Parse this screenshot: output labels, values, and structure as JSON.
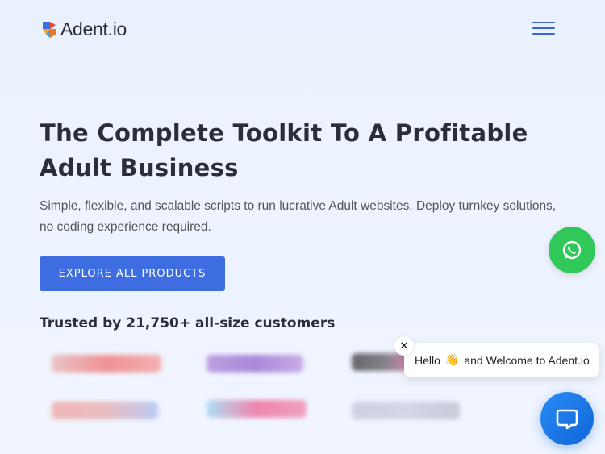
{
  "header": {
    "logo_text": "Adent.io",
    "menu_icon": "hamburger-menu-icon"
  },
  "hero": {
    "title": "The Complete Toolkit To A Profitable Adult Business",
    "subtitle": "Simple, flexible, and scalable scripts to run lucrative Adult websites. Deploy turnkey solutions, no coding experience required.",
    "cta_label": "EXPLORE ALL PRODUCTS"
  },
  "trusted": {
    "heading": "Trusted by 21,750+ all-size customers"
  },
  "chat": {
    "greeting_before": "Hello",
    "greeting_emoji": "👋",
    "greeting_after": "and Welcome to Adent.io",
    "close_label": "✕",
    "whatsapp_icon": "whatsapp-icon",
    "chat_icon": "chat-bubble-icon"
  },
  "colors": {
    "accent": "#3d6de0",
    "whatsapp": "#31c85a",
    "chat": "#1a7ae8"
  }
}
